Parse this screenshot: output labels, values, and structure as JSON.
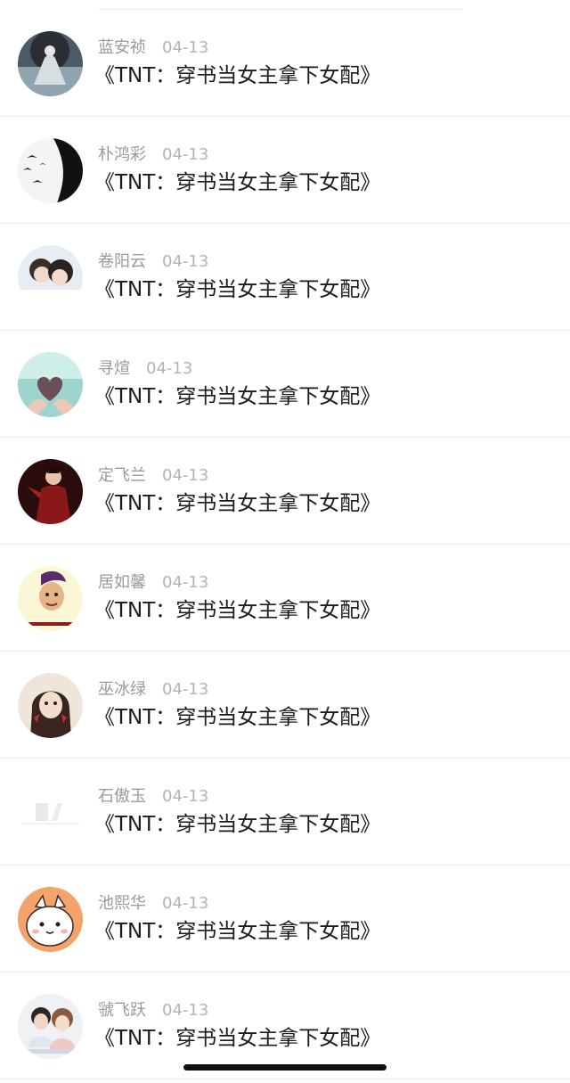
{
  "comments": [
    {
      "name": "蓝安祯",
      "date": "04-13",
      "text": "《TNT：穿书当女主拿下女配》",
      "avatar_icon": "avatar-dark-figure"
    },
    {
      "name": "朴鸿彩",
      "date": "04-13",
      "text": "《TNT：穿书当女主拿下女配》",
      "avatar_icon": "avatar-bw-birds"
    },
    {
      "name": "卷阳云",
      "date": "04-13",
      "text": "《TNT：穿书当女主拿下女配》",
      "avatar_icon": "avatar-couple"
    },
    {
      "name": "寻煊",
      "date": "04-13",
      "text": "《TNT：穿书当女主拿下女配》",
      "avatar_icon": "avatar-hands-heart"
    },
    {
      "name": "定飞兰",
      "date": "04-13",
      "text": "《TNT：穿书当女主拿下女配》",
      "avatar_icon": "avatar-dark-red"
    },
    {
      "name": "居如馨",
      "date": "04-13",
      "text": "《TNT：穿书当女主拿下女配》",
      "avatar_icon": "avatar-cartoon-face"
    },
    {
      "name": "巫冰绿",
      "date": "04-13",
      "text": "《TNT：穿书当女主拿下女配》",
      "avatar_icon": "avatar-girl-portrait"
    },
    {
      "name": "石傲玉",
      "date": "04-13",
      "text": "《TNT：穿书当女主拿下女配》",
      "avatar_icon": "avatar-faded-white"
    },
    {
      "name": "池熙华",
      "date": "04-13",
      "text": "《TNT：穿书当女主拿下女配》",
      "avatar_icon": "avatar-cartoon-bunny"
    },
    {
      "name": "虢飞跃",
      "date": "04-13",
      "text": "《TNT：穿书当女主拿下女配》",
      "avatar_icon": "avatar-couple-photo"
    }
  ],
  "colors": {
    "name": "#9a9a9a",
    "date": "#b4b4b4",
    "text": "#1a1a1a",
    "divider": "#f0f0f0"
  }
}
